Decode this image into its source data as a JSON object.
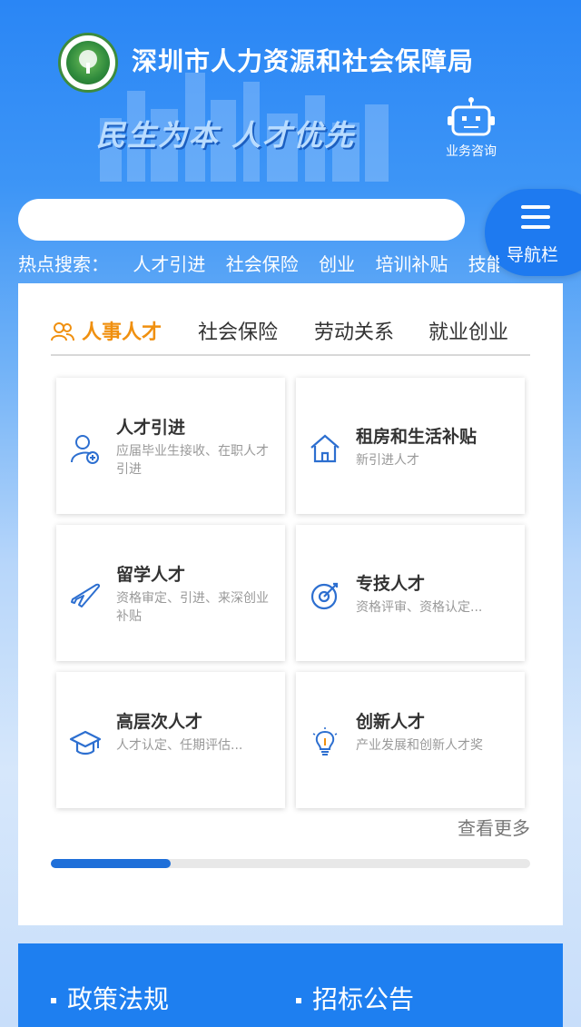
{
  "header": {
    "org_title": "深圳市人力资源和社会保障局",
    "slogan": "民生为本 人才优先",
    "consult_label": "业务咨询"
  },
  "search": {
    "placeholder": "",
    "nav_label": "导航栏"
  },
  "hot_search": {
    "label": "热点搜索：",
    "items": [
      "人才引进",
      "社会保险",
      "创业",
      "培训补贴",
      "技能"
    ]
  },
  "tabs": [
    {
      "label": "人事人才",
      "active": true
    },
    {
      "label": "社会保险",
      "active": false
    },
    {
      "label": "劳动关系",
      "active": false
    },
    {
      "label": "就业创业",
      "active": false
    }
  ],
  "tiles": [
    {
      "title": "人才引进",
      "desc": "应届毕业生接收、在职人才引进",
      "icon": "add-user-icon"
    },
    {
      "title": "租房和生活补贴",
      "desc": "新引进人才",
      "icon": "house-icon"
    },
    {
      "title": "留学人才",
      "desc": "资格审定、引进、来深创业补贴",
      "icon": "airplane-icon"
    },
    {
      "title": "专技人才",
      "desc": "资格评审、资格认定...",
      "icon": "target-icon"
    },
    {
      "title": "高层次人才",
      "desc": "人才认定、任期评估...",
      "icon": "graduation-cap-icon"
    },
    {
      "title": "创新人才",
      "desc": "产业发展和创新人才奖",
      "icon": "lightbulb-icon"
    }
  ],
  "more_label": "查看更多",
  "progress": 0.25,
  "bottom_tabs": [
    "政策法规",
    "招标公告"
  ],
  "colors": {
    "accent": "#1e7af0",
    "active_tab": "#f0900f",
    "icon_blue": "#2d6fd0"
  }
}
